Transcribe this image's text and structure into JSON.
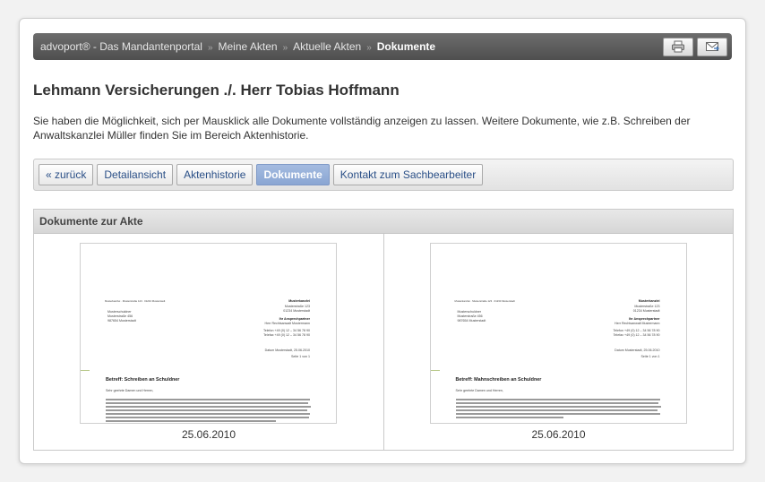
{
  "breadcrumb": {
    "items": [
      "advoport® - Das Mandantenportal",
      "Meine Akten",
      "Aktuelle Akten"
    ],
    "current": "Dokumente",
    "separator": "»"
  },
  "toolbar": {
    "print_icon": "printer-icon",
    "mail_icon": "mail-icon"
  },
  "page": {
    "title": "Lehmann Versicherungen ./. Herr Tobias Hoffmann",
    "intro": "Sie haben die Möglichkeit, sich per Mausklick alle Dokumente vollständig anzeigen zu lassen. Weitere Dokumente, wie z.B. Schreiben der Anwaltskanzlei Müller finden Sie im Bereich Aktenhistorie."
  },
  "tabs": [
    {
      "label": "« zurück",
      "active": false
    },
    {
      "label": "Detailansicht",
      "active": false
    },
    {
      "label": "Aktenhistorie",
      "active": false
    },
    {
      "label": "Dokumente",
      "active": true
    },
    {
      "label": "Kontakt zum Sachbearbeiter",
      "active": false
    }
  ],
  "documents_panel": {
    "heading": "Dokumente zur Akte",
    "documents": [
      {
        "date": "25.06.2010",
        "letter": {
          "sender_line": "Musterkanzlei · Musterstraße 123 · 01234 Musterstadt",
          "recipient": [
            "Musterschuldner",
            "Musterstraße 456",
            "987654 Musterstadt"
          ],
          "firm": "Musterkanzlei",
          "firm_address": [
            "Musterstraße 123",
            "01234 Musterstadt"
          ],
          "contact_label": "Ihr Ansprechpartner",
          "contact_name": "Herr Rechtsanwalt Mustermann",
          "phone": "Telefon +49 (0) 12 – 34 56 78 90",
          "fax": "Telefax +49 (0) 12 – 34 56 78 90",
          "date_line": "Datum Musterstadt, 25.06.2010",
          "page_line": "Seite 1 von 1",
          "subject": "Betreff: Schreiben an Schuldner",
          "salutation": "Sehr geehrte Damen und Herren,"
        }
      },
      {
        "date": "25.06.2010",
        "letter": {
          "sender_line": "Musterkanzlei · Musterstraße 123 · 01234 Musterstadt",
          "recipient": [
            "Musterschuldner",
            "Musterstraße 456",
            "987654 Musterstadt"
          ],
          "firm": "Musterkanzlei",
          "firm_address": [
            "Musterstraße 123",
            "01234 Musterstadt"
          ],
          "contact_label": "Ihr Ansprechpartner",
          "contact_name": "Herr Rechtsanwalt Mustermann",
          "phone": "Telefon +49 (0) 12 – 34 56 78 90",
          "fax": "Telefax +49 (0) 12 – 34 56 78 90",
          "date_line": "Datum Musterstadt, 25.06.2010",
          "page_line": "Seite 1 von 1",
          "subject": "Betreff: Mahnschreiben an Schuldner",
          "salutation": "Sehr geehrte Damen und Herren,"
        }
      }
    ]
  }
}
